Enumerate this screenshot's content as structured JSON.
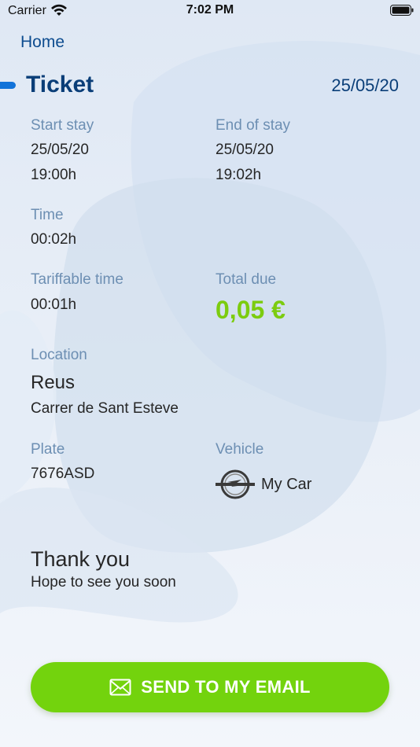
{
  "status_bar": {
    "carrier": "Carrier",
    "time": "7:02 PM"
  },
  "nav": {
    "home": "Home"
  },
  "ticket": {
    "title": "Ticket",
    "date": "25/05/20"
  },
  "stay": {
    "start_label": "Start stay",
    "start_date": "25/05/20",
    "start_time": "19:00h",
    "end_label": "End of stay",
    "end_date": "25/05/20",
    "end_time": "19:02h"
  },
  "duration": {
    "time_label": "Time",
    "time_value": "00:02h",
    "tariffable_label": "Tariffable time",
    "tariffable_value": "00:01h"
  },
  "payment": {
    "total_label": "Total due",
    "total_value": "0,05 €"
  },
  "location": {
    "label": "Location",
    "city": "Reus",
    "street": "Carrer de Sant Esteve"
  },
  "plate": {
    "label": "Plate",
    "value": "7676ASD"
  },
  "vehicle": {
    "label": "Vehicle",
    "name": "My Car",
    "brand_icon": "opel-logo-icon"
  },
  "thanks": {
    "title": "Thank you",
    "subtitle": "Hope to see you soon"
  },
  "actions": {
    "send_email": "SEND TO MY EMAIL",
    "send_icon": "mail-icon"
  },
  "colors": {
    "accent_blue": "#0a3e78",
    "label_blue": "#6d8fb3",
    "total_green": "#7ccc0f",
    "button_green": "#73d30d"
  }
}
